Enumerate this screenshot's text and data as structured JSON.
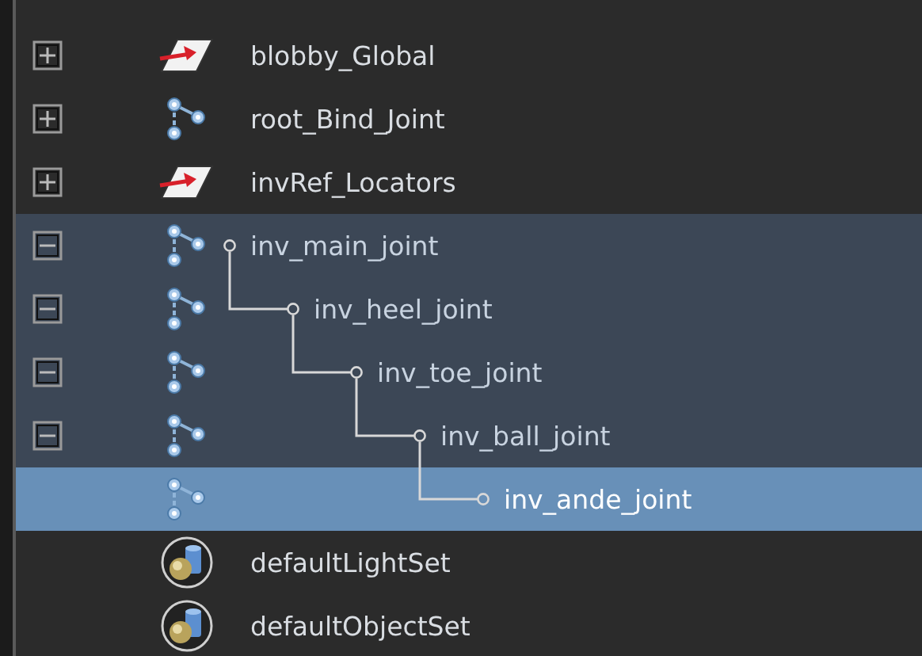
{
  "outliner": {
    "items": [
      {
        "name": "blobby_Global",
        "kind": "locator",
        "expanded": false,
        "selected": false
      },
      {
        "name": "root_Bind_Joint",
        "kind": "joint",
        "expanded": false,
        "selected": false
      },
      {
        "name": "invRef_Locators",
        "kind": "locator",
        "expanded": false,
        "selected": false
      },
      {
        "name": "inv_main_joint",
        "kind": "joint",
        "expanded": true,
        "selected": false,
        "children": [
          {
            "name": "inv_heel_joint",
            "kind": "joint",
            "expanded": true,
            "selected": false,
            "children": [
              {
                "name": "inv_toe_joint",
                "kind": "joint",
                "expanded": true,
                "selected": false,
                "children": [
                  {
                    "name": "inv_ball_joint",
                    "kind": "joint",
                    "expanded": true,
                    "selected": false,
                    "children": [
                      {
                        "name": "inv_ande_joint",
                        "kind": "joint",
                        "selected": true
                      }
                    ]
                  }
                ]
              }
            ]
          }
        ]
      },
      {
        "name": "defaultLightSet",
        "kind": "set",
        "selected": false
      },
      {
        "name": "defaultObjectSet",
        "kind": "set",
        "selected": false
      }
    ]
  }
}
